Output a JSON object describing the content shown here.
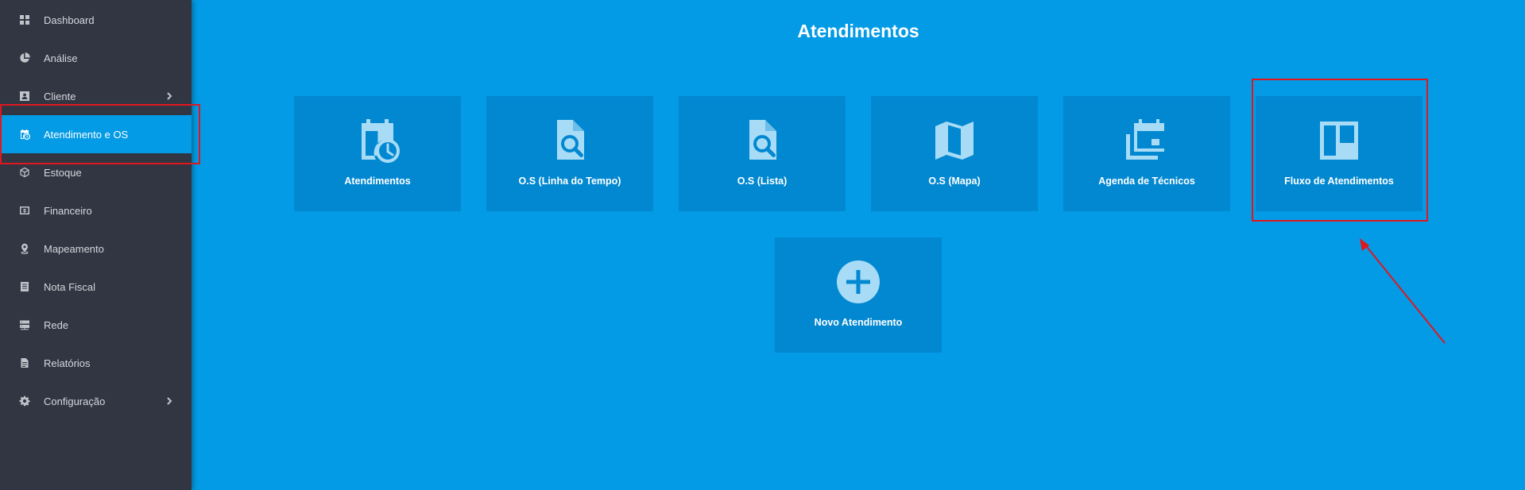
{
  "sidebar": {
    "items": [
      {
        "label": "Dashboard",
        "icon": "dashboard-icon"
      },
      {
        "label": "Análise",
        "icon": "pie-chart-icon"
      },
      {
        "label": "Cliente",
        "icon": "contact-card-icon",
        "has_submenu": true
      },
      {
        "label": "Atendimento e OS",
        "icon": "calendar-clock-icon",
        "active": true
      },
      {
        "label": "Estoque",
        "icon": "box-icon"
      },
      {
        "label": "Financeiro",
        "icon": "money-icon"
      },
      {
        "label": "Mapeamento",
        "icon": "map-pin-icon"
      },
      {
        "label": "Nota Fiscal",
        "icon": "receipt-icon"
      },
      {
        "label": "Rede",
        "icon": "server-icon"
      },
      {
        "label": "Relatórios",
        "icon": "document-icon"
      },
      {
        "label": "Configuração",
        "icon": "gear-icon",
        "has_submenu": true
      }
    ]
  },
  "main": {
    "title": "Atendimentos",
    "tiles": [
      {
        "label": "Atendimentos",
        "icon": "calendar-clock-icon"
      },
      {
        "label": "O.S (Linha do Tempo)",
        "icon": "file-search-icon"
      },
      {
        "label": "O.S (Lista)",
        "icon": "file-search-icon"
      },
      {
        "label": "O.S (Mapa)",
        "icon": "map-icon"
      },
      {
        "label": "Agenda de Técnicos",
        "icon": "calendar-multiple-icon"
      },
      {
        "label": "Fluxo de Atendimentos",
        "icon": "kanban-board-icon"
      },
      {
        "label": "Novo Atendimento",
        "icon": "plus-circle-icon"
      }
    ]
  },
  "colors": {
    "sidebar_bg": "#323642",
    "main_bg": "#039be5",
    "tile_bg": "#0288d1",
    "icon_color": "#a8dcf6",
    "highlight": "#e0171f"
  }
}
